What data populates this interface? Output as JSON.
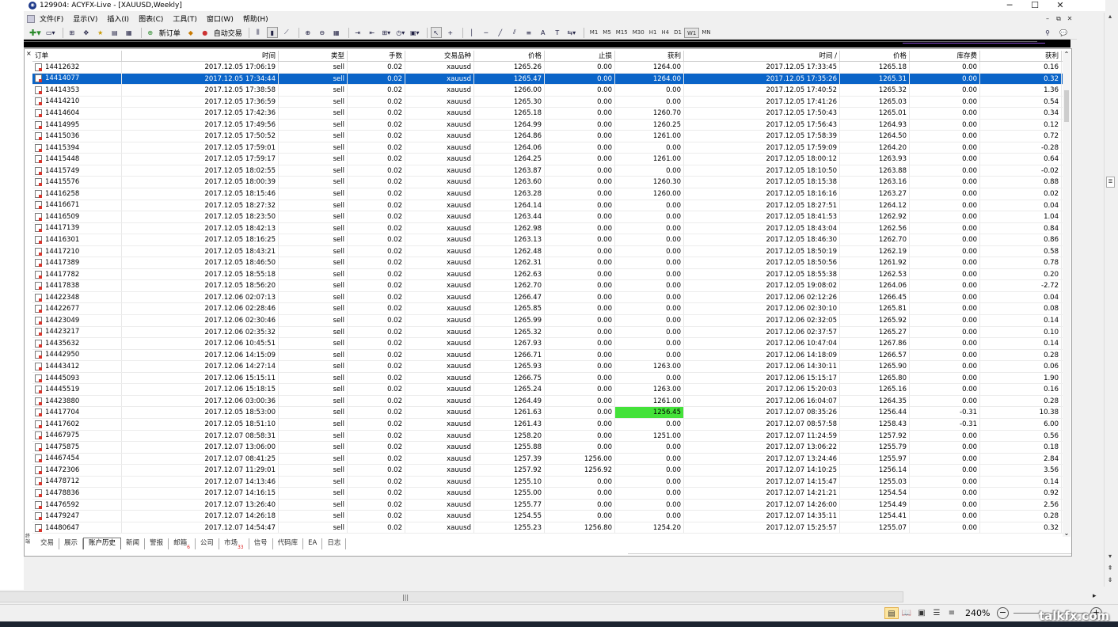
{
  "window": {
    "title": "129904: ACYFX-Live - [XAUUSD,Weekly]",
    "controls": [
      "─",
      "☐",
      "✕"
    ]
  },
  "menu": {
    "items": [
      "文件(F)",
      "显示(V)",
      "插入(I)",
      "图表(C)",
      "工具(T)",
      "窗口(W)",
      "帮助(H)"
    ],
    "mdi_controls": [
      "–",
      "⧉",
      "✕"
    ]
  },
  "toolbar": {
    "new_order": "新订单",
    "auto_trading": "自动交易",
    "text_tool": "A",
    "timeframes": [
      "M1",
      "M5",
      "M15",
      "M30",
      "H1",
      "H4",
      "D1",
      "W1",
      "MN"
    ],
    "active_timeframe": "W1"
  },
  "terminal": {
    "close_label": "×",
    "vertical_label": "终端",
    "columns": [
      "订单",
      "时间",
      "类型",
      "手数",
      "交易品种",
      "价格",
      "止损",
      "获利",
      "时间 /",
      "价格",
      "库存费",
      "获利"
    ],
    "rows": [
      [
        "14412632",
        "2017.12.05 17:06:19",
        "sell",
        "0.02",
        "xauusd",
        "1265.26",
        "0.00",
        "1264.00",
        "2017.12.05 17:33:45",
        "1265.18",
        "0.00",
        "0.16"
      ],
      [
        "14414077",
        "2017.12.05 17:34:44",
        "sell",
        "0.02",
        "xauusd",
        "1265.47",
        "0.00",
        "1264.00",
        "2017.12.05 17:35:26",
        "1265.31",
        "0.00",
        "0.32"
      ],
      [
        "14414353",
        "2017.12.05 17:38:58",
        "sell",
        "0.02",
        "xauusd",
        "1266.00",
        "0.00",
        "0.00",
        "2017.12.05 17:40:52",
        "1265.32",
        "0.00",
        "1.36"
      ],
      [
        "14414210",
        "2017.12.05 17:36:59",
        "sell",
        "0.02",
        "xauusd",
        "1265.30",
        "0.00",
        "0.00",
        "2017.12.05 17:41:26",
        "1265.03",
        "0.00",
        "0.54"
      ],
      [
        "14414604",
        "2017.12.05 17:42:36",
        "sell",
        "0.02",
        "xauusd",
        "1265.18",
        "0.00",
        "1260.70",
        "2017.12.05 17:50:43",
        "1265.01",
        "0.00",
        "0.34"
      ],
      [
        "14414995",
        "2017.12.05 17:49:56",
        "sell",
        "0.02",
        "xauusd",
        "1264.99",
        "0.00",
        "1260.25",
        "2017.12.05 17:56:43",
        "1264.93",
        "0.00",
        "0.12"
      ],
      [
        "14415036",
        "2017.12.05 17:50:52",
        "sell",
        "0.02",
        "xauusd",
        "1264.86",
        "0.00",
        "1261.00",
        "2017.12.05 17:58:39",
        "1264.50",
        "0.00",
        "0.72"
      ],
      [
        "14415394",
        "2017.12.05 17:59:01",
        "sell",
        "0.02",
        "xauusd",
        "1264.06",
        "0.00",
        "0.00",
        "2017.12.05 17:59:09",
        "1264.20",
        "0.00",
        "-0.28"
      ],
      [
        "14415448",
        "2017.12.05 17:59:17",
        "sell",
        "0.02",
        "xauusd",
        "1264.25",
        "0.00",
        "1261.00",
        "2017.12.05 18:00:12",
        "1263.93",
        "0.00",
        "0.64"
      ],
      [
        "14415749",
        "2017.12.05 18:02:55",
        "sell",
        "0.02",
        "xauusd",
        "1263.87",
        "0.00",
        "0.00",
        "2017.12.05 18:10:50",
        "1263.88",
        "0.00",
        "-0.02"
      ],
      [
        "14415576",
        "2017.12.05 18:00:39",
        "sell",
        "0.02",
        "xauusd",
        "1263.60",
        "0.00",
        "1260.30",
        "2017.12.05 18:15:38",
        "1263.16",
        "0.00",
        "0.88"
      ],
      [
        "14416258",
        "2017.12.05 18:15:46",
        "sell",
        "0.02",
        "xauusd",
        "1263.28",
        "0.00",
        "1260.00",
        "2017.12.05 18:16:16",
        "1263.27",
        "0.00",
        "0.02"
      ],
      [
        "14416671",
        "2017.12.05 18:27:32",
        "sell",
        "0.02",
        "xauusd",
        "1264.14",
        "0.00",
        "0.00",
        "2017.12.05 18:27:51",
        "1264.12",
        "0.00",
        "0.04"
      ],
      [
        "14416509",
        "2017.12.05 18:23:50",
        "sell",
        "0.02",
        "xauusd",
        "1263.44",
        "0.00",
        "0.00",
        "2017.12.05 18:41:53",
        "1262.92",
        "0.00",
        "1.04"
      ],
      [
        "14417139",
        "2017.12.05 18:42:13",
        "sell",
        "0.02",
        "xauusd",
        "1262.98",
        "0.00",
        "0.00",
        "2017.12.05 18:43:04",
        "1262.56",
        "0.00",
        "0.84"
      ],
      [
        "14416301",
        "2017.12.05 18:16:25",
        "sell",
        "0.02",
        "xauusd",
        "1263.13",
        "0.00",
        "0.00",
        "2017.12.05 18:46:30",
        "1262.70",
        "0.00",
        "0.86"
      ],
      [
        "14417210",
        "2017.12.05 18:43:21",
        "sell",
        "0.02",
        "xauusd",
        "1262.48",
        "0.00",
        "0.00",
        "2017.12.05 18:50:19",
        "1262.19",
        "0.00",
        "0.58"
      ],
      [
        "14417389",
        "2017.12.05 18:46:50",
        "sell",
        "0.02",
        "xauusd",
        "1262.31",
        "0.00",
        "0.00",
        "2017.12.05 18:50:56",
        "1261.92",
        "0.00",
        "0.78"
      ],
      [
        "14417782",
        "2017.12.05 18:55:18",
        "sell",
        "0.02",
        "xauusd",
        "1262.63",
        "0.00",
        "0.00",
        "2017.12.05 18:55:38",
        "1262.53",
        "0.00",
        "0.20"
      ],
      [
        "14417838",
        "2017.12.05 18:56:20",
        "sell",
        "0.02",
        "xauusd",
        "1262.70",
        "0.00",
        "0.00",
        "2017.12.05 19:08:02",
        "1264.06",
        "0.00",
        "-2.72"
      ],
      [
        "14422348",
        "2017.12.06 02:07:13",
        "sell",
        "0.02",
        "xauusd",
        "1266.47",
        "0.00",
        "0.00",
        "2017.12.06 02:12:26",
        "1266.45",
        "0.00",
        "0.04"
      ],
      [
        "14422677",
        "2017.12.06 02:28:46",
        "sell",
        "0.02",
        "xauusd",
        "1265.85",
        "0.00",
        "0.00",
        "2017.12.06 02:30:10",
        "1265.81",
        "0.00",
        "0.08"
      ],
      [
        "14423049",
        "2017.12.06 02:30:46",
        "sell",
        "0.02",
        "xauusd",
        "1265.99",
        "0.00",
        "0.00",
        "2017.12.06 02:32:05",
        "1265.92",
        "0.00",
        "0.14"
      ],
      [
        "14423217",
        "2017.12.06 02:35:32",
        "sell",
        "0.02",
        "xauusd",
        "1265.32",
        "0.00",
        "0.00",
        "2017.12.06 02:37:57",
        "1265.27",
        "0.00",
        "0.10"
      ],
      [
        "14435632",
        "2017.12.06 10:45:51",
        "sell",
        "0.02",
        "xauusd",
        "1267.93",
        "0.00",
        "0.00",
        "2017.12.06 10:47:04",
        "1267.86",
        "0.00",
        "0.14"
      ],
      [
        "14442950",
        "2017.12.06 14:15:09",
        "sell",
        "0.02",
        "xauusd",
        "1266.71",
        "0.00",
        "0.00",
        "2017.12.06 14:18:09",
        "1266.57",
        "0.00",
        "0.28"
      ],
      [
        "14443412",
        "2017.12.06 14:27:14",
        "sell",
        "0.02",
        "xauusd",
        "1265.93",
        "0.00",
        "1263.00",
        "2017.12.06 14:30:11",
        "1265.90",
        "0.00",
        "0.06"
      ],
      [
        "14445093",
        "2017.12.06 15:15:11",
        "sell",
        "0.02",
        "xauusd",
        "1266.75",
        "0.00",
        "0.00",
        "2017.12.06 15:15:17",
        "1265.80",
        "0.00",
        "1.90"
      ],
      [
        "14445519",
        "2017.12.06 15:18:15",
        "sell",
        "0.02",
        "xauusd",
        "1265.24",
        "0.00",
        "1263.00",
        "2017.12.06 15:20:03",
        "1265.16",
        "0.00",
        "0.16"
      ],
      [
        "14423880",
        "2017.12.06 03:00:36",
        "sell",
        "0.02",
        "xauusd",
        "1264.49",
        "0.00",
        "1261.00",
        "2017.12.06 16:04:07",
        "1264.35",
        "0.00",
        "0.28"
      ],
      [
        "14417704",
        "2017.12.05 18:53:00",
        "sell",
        "0.02",
        "xauusd",
        "1261.63",
        "0.00",
        "1256.45",
        "2017.12.07 08:35:26",
        "1256.44",
        "-0.31",
        "10.38"
      ],
      [
        "14417602",
        "2017.12.05 18:51:10",
        "sell",
        "0.02",
        "xauusd",
        "1261.43",
        "0.00",
        "0.00",
        "2017.12.07 08:57:58",
        "1258.43",
        "-0.31",
        "6.00"
      ],
      [
        "14467975",
        "2017.12.07 08:58:31",
        "sell",
        "0.02",
        "xauusd",
        "1258.20",
        "0.00",
        "1251.00",
        "2017.12.07 11:24:59",
        "1257.92",
        "0.00",
        "0.56"
      ],
      [
        "14475875",
        "2017.12.07 13:06:00",
        "sell",
        "0.02",
        "xauusd",
        "1255.88",
        "0.00",
        "0.00",
        "2017.12.07 13:06:22",
        "1255.79",
        "0.00",
        "0.18"
      ],
      [
        "14467454",
        "2017.12.07 08:41:25",
        "sell",
        "0.02",
        "xauusd",
        "1257.39",
        "1256.00",
        "0.00",
        "2017.12.07 13:24:46",
        "1255.97",
        "0.00",
        "2.84"
      ],
      [
        "14472306",
        "2017.12.07 11:29:01",
        "sell",
        "0.02",
        "xauusd",
        "1257.92",
        "1256.92",
        "0.00",
        "2017.12.07 14:10:25",
        "1256.14",
        "0.00",
        "3.56"
      ],
      [
        "14478712",
        "2017.12.07 14:13:46",
        "sell",
        "0.02",
        "xauusd",
        "1255.10",
        "0.00",
        "0.00",
        "2017.12.07 14:15:47",
        "1255.03",
        "0.00",
        "0.14"
      ],
      [
        "14478836",
        "2017.12.07 14:16:15",
        "sell",
        "0.02",
        "xauusd",
        "1255.00",
        "0.00",
        "0.00",
        "2017.12.07 14:21:21",
        "1254.54",
        "0.00",
        "0.92"
      ],
      [
        "14476592",
        "2017.12.07 13:26:40",
        "sell",
        "0.02",
        "xauusd",
        "1255.77",
        "0.00",
        "0.00",
        "2017.12.07 14:26:00",
        "1254.49",
        "0.00",
        "2.56"
      ],
      [
        "14479247",
        "2017.12.07 14:26:18",
        "sell",
        "0.02",
        "xauusd",
        "1254.55",
        "0.00",
        "0.00",
        "2017.12.07 14:35:11",
        "1254.41",
        "0.00",
        "0.28"
      ],
      [
        "14480647",
        "2017.12.07 14:54:47",
        "sell",
        "0.02",
        "xauusd",
        "1255.23",
        "1256.80",
        "1254.20",
        "2017.12.07 15:25:57",
        "1255.07",
        "0.00",
        "0.32"
      ]
    ],
    "selected_order": "14414077",
    "highlighted_cell": {
      "order": "14417704",
      "column": "获利",
      "color": "#44e23a"
    },
    "tabs": [
      {
        "label": "交易",
        "badge": ""
      },
      {
        "label": "展示",
        "badge": ""
      },
      {
        "label": "账户历史",
        "badge": ""
      },
      {
        "label": "新闻",
        "badge": ""
      },
      {
        "label": "警报",
        "badge": ""
      },
      {
        "label": "邮箱",
        "badge": "6"
      },
      {
        "label": "公司",
        "badge": ""
      },
      {
        "label": "市场",
        "badge": "33"
      },
      {
        "label": "信号",
        "badge": ""
      },
      {
        "label": "代码库",
        "badge": ""
      },
      {
        "label": "EA",
        "badge": ""
      },
      {
        "label": "日志",
        "badge": ""
      }
    ],
    "active_tab": "账户历史"
  },
  "statusbar": {
    "zoom": "240%",
    "zoom_minus": "−",
    "zoom_plus": "+",
    "watermark": "talkfx.com"
  },
  "colors": {
    "selection": "#0a64c8",
    "tp_highlight": "#44e23a",
    "badge": "#d22222"
  }
}
